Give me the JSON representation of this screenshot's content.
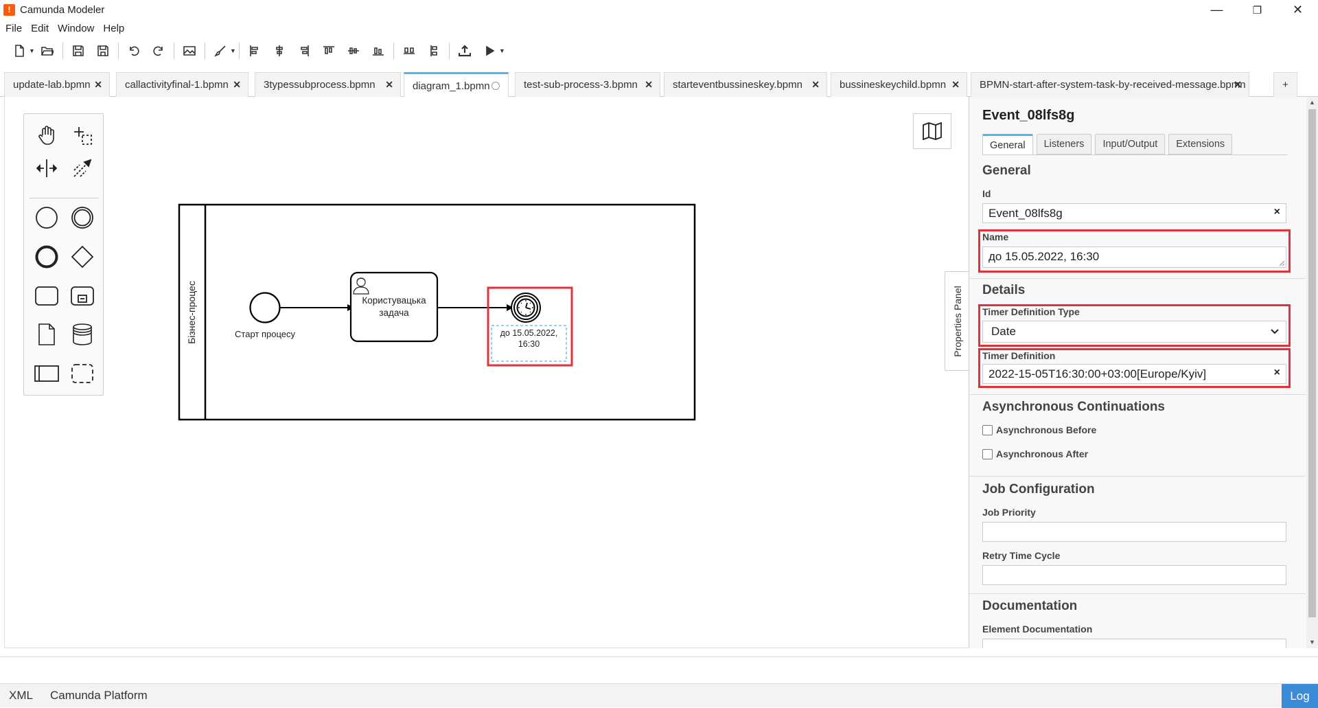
{
  "window": {
    "logo_glyph": "!",
    "title": "Camunda Modeler",
    "minimize": "—",
    "maximize": "❐",
    "close": "✕"
  },
  "menu": [
    "File",
    "Edit",
    "Window",
    "Help"
  ],
  "tabs": [
    {
      "label": "update-lab.bpmn",
      "close": "✕"
    },
    {
      "label": "callactivityfinal-1.bpmn",
      "close": "✕"
    },
    {
      "label": "3typessubprocess.bpmn",
      "close": "✕"
    },
    {
      "label": "diagram_1.bpmn",
      "active": true
    },
    {
      "label": "test-sub-process-3.bpmn",
      "close": "✕"
    },
    {
      "label": "starteventbussineskey.bpmn",
      "close": "✕"
    },
    {
      "label": "bussineskeychild.bpmn",
      "close": "✕"
    },
    {
      "label": "BPMN-start-after-system-task-by-received-message.bpmn",
      "close": "✕"
    }
  ],
  "new_tab": "+",
  "diagram": {
    "lane_label": "Бізнес-процес",
    "start_event_label": "Старт процесу",
    "task_label_line1": "Користувацька",
    "task_label_line2": "задача",
    "timer_label_line1": "до 15.05.2022,",
    "timer_label_line2": "16:30"
  },
  "properties_panel_toggle": "Properties Panel",
  "properties": {
    "title": "Event_08lfs8g",
    "tabs": [
      "General",
      "Listeners",
      "Input/Output",
      "Extensions"
    ],
    "active_tab": "General",
    "general_group": "General",
    "id_label": "Id",
    "id_value": "Event_08lfs8g",
    "clear": "×",
    "name_label": "Name",
    "name_value": "до 15.05.2022, 16:30",
    "details_group": "Details",
    "timer_type_label": "Timer Definition Type",
    "timer_type_value": "Date",
    "timer_def_label": "Timer Definition",
    "timer_def_value": "2022-15-05T16:30:00+03:00[Europe/Kyiv]",
    "async_group": "Asynchronous Continuations",
    "async_before": "Asynchronous Before",
    "async_after": "Asynchronous After",
    "job_group": "Job Configuration",
    "job_priority_label": "Job Priority",
    "retry_label": "Retry Time Cycle",
    "doc_group": "Documentation",
    "element_doc_label": "Element Documentation"
  },
  "statusbar": {
    "xml": "XML",
    "platform": "Camunda Platform",
    "log": "Log"
  },
  "colors": {
    "accent": "#52b4ec",
    "highlight": "#e0323a",
    "log_button": "#3b8bd9",
    "app_logo": "#fc5d0d"
  }
}
